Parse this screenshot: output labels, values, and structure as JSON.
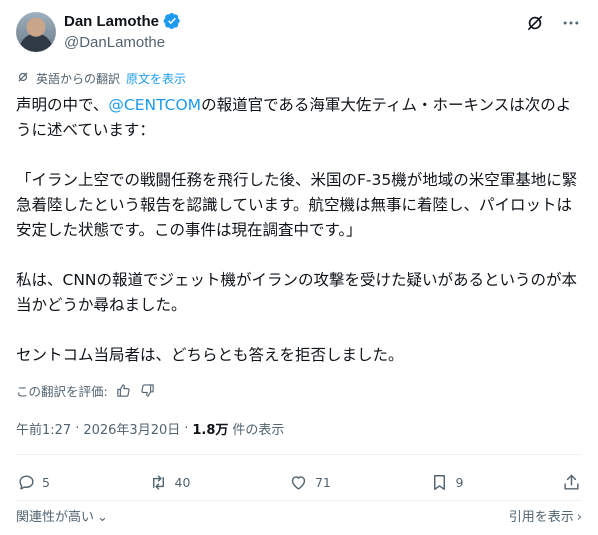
{
  "author": {
    "name": "Dan Lamothe",
    "handle": "@DanLamothe",
    "verified_color": "#1d9bf0"
  },
  "header_icons": [
    "grok-icon",
    "more-icon"
  ],
  "translation": {
    "label": "英語からの翻訳",
    "show_original": "原文を表示"
  },
  "tweet": {
    "p1_before": "声明の中で、",
    "p1_mention": "@CENTCOM",
    "p1_after": "の報道官である海軍大佐ティム・ホーキンスは次のように述べています：",
    "p2": "「イラン上空での戦闘任務を飛行した後、米国のF-35機が地域の米空軍基地に緊急着陸したという報告を認識しています。航空機は無事に着陸し、パイロットは安定した状態です。この事件は現在調査中です。」",
    "p3": "私は、CNNの報道でジェット機がイランの攻撃を受けた疑いがあるというのが本当かどうか尋ねました。",
    "p4": "セントコム当局者は、どちらとも答えを拒否しました。"
  },
  "rate_translation": {
    "label": "この翻訳を評価:"
  },
  "meta": {
    "time": "午前1:27",
    "separator": "·",
    "date": "2026年3月20日",
    "views_count": "1.8万",
    "views_label": "件の表示"
  },
  "actions": {
    "replies": "5",
    "reposts": "40",
    "likes": "71",
    "bookmarks": "9"
  },
  "footer": {
    "sort_label": "関連性が高い",
    "quotes_label": "引用を表示"
  },
  "colors": {
    "accent": "#1d9bf0",
    "text": "#0f1419",
    "muted": "#536471"
  }
}
